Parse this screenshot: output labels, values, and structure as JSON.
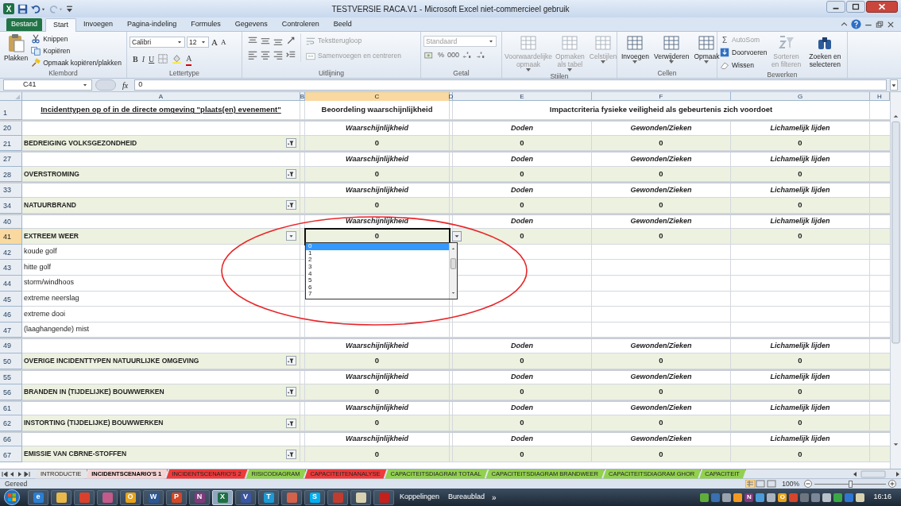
{
  "window": {
    "app_glyph": "X",
    "title": "TESTVERSIE RACA.V1  -  Microsoft Excel niet-commercieel gebruik"
  },
  "ribbon_tabs": [
    {
      "label": "Bestand",
      "kind": "file",
      "selected": false
    },
    {
      "label": "Start",
      "kind": "tab",
      "selected": true
    },
    {
      "label": "Invoegen",
      "kind": "tab",
      "selected": false
    },
    {
      "label": "Pagina-indeling",
      "kind": "tab",
      "selected": false
    },
    {
      "label": "Formules",
      "kind": "tab",
      "selected": false
    },
    {
      "label": "Gegevens",
      "kind": "tab",
      "selected": false
    },
    {
      "label": "Controleren",
      "kind": "tab",
      "selected": false
    },
    {
      "label": "Beeld",
      "kind": "tab",
      "selected": false
    }
  ],
  "ribbon_groups": [
    {
      "kind": "clipboard",
      "label": "Klembord",
      "paste": "Plakken",
      "items": [
        {
          "label": "Knippen"
        },
        {
          "label": "Kopiëren"
        },
        {
          "label": "Opmaak kopiëren/plakken"
        }
      ]
    },
    {
      "kind": "font",
      "label": "Lettertype",
      "font": "Calibri",
      "size": "12",
      "size_buttons": [
        "A",
        "A"
      ],
      "format_buttons": [
        {
          "kind": "bold",
          "glyph": "B"
        },
        {
          "kind": "italic",
          "glyph": "I"
        },
        {
          "kind": "underline",
          "glyph": "U"
        }
      ],
      "color_button": "A"
    },
    {
      "kind": "align",
      "label": "Uitlijning",
      "items": [
        {
          "label": "Tekstterugloop",
          "disabled": true
        },
        {
          "label": "Samenvoegen en centreren",
          "disabled": true
        }
      ]
    },
    {
      "kind": "number",
      "label": "Getal",
      "format": "Standaard",
      "disabled": true,
      "symbols": [
        "%",
        "000"
      ]
    },
    {
      "kind": "large",
      "label": "Stijlen",
      "items": [
        {
          "label": "Voorwaardelijke opmaak",
          "disabled": true
        },
        {
          "label": "Opmaken als tabel",
          "disabled": true
        },
        {
          "label": "Celstijlen",
          "disabled": true
        }
      ]
    },
    {
      "kind": "large",
      "label": "Cellen",
      "items": [
        {
          "label": "Invoegen",
          "disabled": false
        },
        {
          "label": "Verwijderen",
          "disabled": false
        },
        {
          "label": "Opmaak",
          "disabled": false
        }
      ]
    },
    {
      "kind": "edit",
      "label": "Bewerken",
      "small": [
        {
          "label": "AutoSom",
          "glyph": "Σ",
          "disabled": true
        },
        {
          "label": "Doorvoeren",
          "disabled": false
        },
        {
          "label": "Wissen",
          "disabled": false
        }
      ],
      "large": [
        {
          "label": "Sorteren en filteren",
          "disabled": true
        },
        {
          "label": "Zoeken en selecteren",
          "disabled": false
        }
      ]
    }
  ],
  "formula_bar": {
    "name_box": "C41",
    "function_label": "fx",
    "formula": "0"
  },
  "sheet": {
    "columns": [
      {
        "letter": "A",
        "selected": false
      },
      {
        "letter": "B",
        "selected": false
      },
      {
        "letter": "C",
        "selected": true
      },
      {
        "letter": "D",
        "selected": false
      },
      {
        "letter": "E",
        "selected": false
      },
      {
        "letter": "F",
        "selected": false
      },
      {
        "letter": "G",
        "selected": false
      },
      {
        "letter": "H",
        "selected": false
      }
    ],
    "header_row": {
      "number": "1",
      "title": "Incidenttypen op of in de directe omgeving \"plaats(en) evenement\"",
      "assessment": "Beoordeling waarschijnlijkheid",
      "impact": "Impactcriteria fysieke veiligheid als gebeurtenis zich voordoet"
    },
    "rows": [
      {
        "number": "20",
        "kind": "labels",
        "cells": [
          "Waarschijnlijkheid",
          "Doden",
          "Gewonden/Zieken",
          "Lichamelijk lijden"
        ]
      },
      {
        "number": "21",
        "kind": "category",
        "label": "BEDREIGING VOLKSGEZONDHEID",
        "filter_button": true,
        "values": [
          "0",
          "0",
          "0",
          "0"
        ],
        "active": false
      },
      {
        "number": "27",
        "kind": "labels",
        "cells": [
          "Waarschijnlijkheid",
          "Doden",
          "Gewonden/Zieken",
          "Lichamelijk lijden"
        ]
      },
      {
        "number": "28",
        "kind": "category",
        "label": "OVERSTROMING",
        "filter_button": true,
        "values": [
          "0",
          "0",
          "0",
          "0"
        ],
        "active": false
      },
      {
        "number": "33",
        "kind": "labels",
        "cells": [
          "Waarschijnlijkheid",
          "Doden",
          "Gewonden/Zieken",
          "Lichamelijk lijden"
        ]
      },
      {
        "number": "34",
        "kind": "category",
        "label": "NATUURBRAND",
        "filter_button": true,
        "values": [
          "0",
          "0",
          "0",
          "0"
        ],
        "active": false
      },
      {
        "number": "40",
        "kind": "labels",
        "cells": [
          "Waarschijnlijkheid",
          "Doden",
          "Gewonden/Zieken",
          "Lichamelijk lijden"
        ]
      },
      {
        "number": "41",
        "kind": "category",
        "label": "EXTREEM WEER",
        "filter_button": false,
        "values": [
          "0",
          "0",
          "0",
          "0"
        ],
        "active": true
      },
      {
        "number": "42",
        "kind": "item",
        "label": "koude golf"
      },
      {
        "number": "43",
        "kind": "item",
        "label": "hitte golf"
      },
      {
        "number": "44",
        "kind": "item",
        "label": "storm/windhoos"
      },
      {
        "number": "45",
        "kind": "item",
        "label": "extreme neerslag"
      },
      {
        "number": "46",
        "kind": "item",
        "label": "extreme dooi"
      },
      {
        "number": "47",
        "kind": "item",
        "label": "(laaghangende) mist"
      },
      {
        "number": "49",
        "kind": "labels",
        "cells": [
          "Waarschijnlijkheid",
          "Doden",
          "Gewonden/Zieken",
          "Lichamelijk lijden"
        ]
      },
      {
        "number": "50",
        "kind": "category",
        "label": "OVERIGE INCIDENTTYPEN NATUURLIJKE OMGEVING",
        "filter_button": true,
        "values": [
          "0",
          "0",
          "0",
          "0"
        ],
        "active": false
      },
      {
        "number": "55",
        "kind": "labels",
        "cells": [
          "Waarschijnlijkheid",
          "Doden",
          "Gewonden/Zieken",
          "Lichamelijk lijden"
        ]
      },
      {
        "number": "56",
        "kind": "category",
        "label": "BRANDEN IN (TIJDELIJKE) BOUWWERKEN",
        "filter_button": true,
        "values": [
          "0",
          "0",
          "0",
          "0"
        ],
        "active": false
      },
      {
        "number": "61",
        "kind": "labels",
        "cells": [
          "Waarschijnlijkheid",
          "Doden",
          "Gewonden/Zieken",
          "Lichamelijk lijden"
        ]
      },
      {
        "number": "62",
        "kind": "category",
        "label": "INSTORTING (TIJDELIJKE) BOUWWERKEN",
        "filter_button": true,
        "values": [
          "0",
          "0",
          "0",
          "0"
        ],
        "active": false
      },
      {
        "number": "66",
        "kind": "labels",
        "cells": [
          "Waarschijnlijkheid",
          "Doden",
          "Gewonden/Zieken",
          "Lichamelijk lijden"
        ]
      },
      {
        "number": "67",
        "kind": "category",
        "label": "EMISSIE VAN CBRNE-STOFFEN",
        "filter_button": true,
        "values": [
          "0",
          "0",
          "0",
          "0"
        ],
        "active": false
      }
    ],
    "dropdown": [
      {
        "label": "0",
        "selected": true
      },
      {
        "label": "1",
        "selected": false
      },
      {
        "label": "2",
        "selected": false
      },
      {
        "label": "3",
        "selected": false
      },
      {
        "label": "4",
        "selected": false
      },
      {
        "label": "5",
        "selected": false
      },
      {
        "label": "6",
        "selected": false
      },
      {
        "label": "7",
        "selected": false
      }
    ],
    "annotation": {
      "kind": "ellipse",
      "color": "#e8262a"
    }
  },
  "sheet_tabs": [
    {
      "label": "INTRODUCTIE",
      "color": "#e4e4e4",
      "selected": false
    },
    {
      "label": "INCIDENTSCENARIO'S 1",
      "color": "#f4d3d3",
      "selected": true
    },
    {
      "label": "INCIDENTSCENARIO'S 2",
      "color": "#ee3b3b",
      "selected": false
    },
    {
      "label": "RISICODIAGRAM",
      "color": "#92d050",
      "selected": false
    },
    {
      "label": "CAPACITEITENANALYSE",
      "color": "#ee3b3b",
      "selected": false
    },
    {
      "label": "CAPACITEITSDIAGRAM TOTAAL",
      "color": "#92d050",
      "selected": false
    },
    {
      "label": "CAPACITEITSDIAGRAM BRANDWEER",
      "color": "#92d050",
      "selected": false
    },
    {
      "label": "CAPACITEITSDIAGRAM GHOR",
      "color": "#92d050",
      "selected": false
    },
    {
      "label": "CAPACITEIT",
      "color": "#92d050",
      "selected": false
    }
  ],
  "status_bar": {
    "status": "Gereed",
    "zoom": "100%",
    "level": 0.5
  },
  "taskbar": {
    "apps": [
      {
        "glyph": "e",
        "color": "#2a7fd4",
        "selected": false
      },
      {
        "color": "#e8b84a",
        "selected": false
      },
      {
        "color": "#d9412c",
        "selected": false
      },
      {
        "color": "#c25a8a",
        "selected": false
      },
      {
        "glyph": "O",
        "color": "#e8a317",
        "selected": false
      },
      {
        "glyph": "W",
        "color": "#2b5797",
        "selected": false
      },
      {
        "glyph": "P",
        "color": "#d24726",
        "selected": false
      },
      {
        "glyph": "N",
        "color": "#80397b",
        "selected": false
      },
      {
        "glyph": "X",
        "color": "#1d7044",
        "selected": true
      },
      {
        "glyph": "V",
        "color": "#3955a3",
        "selected": false
      },
      {
        "glyph": "T",
        "color": "#1b9ad6",
        "selected": false
      },
      {
        "color": "#d4614a",
        "selected": false
      },
      {
        "glyph": "S",
        "color": "#00aff0",
        "selected": false
      },
      {
        "color": "#c23b2f",
        "selected": false
      },
      {
        "color": "#d8d2b0",
        "selected": false
      },
      {
        "color": "#c4201d",
        "selected": false
      }
    ],
    "toolbars": [
      "Koppelingen",
      "Bureaublad"
    ],
    "more": "»",
    "tray": [
      {
        "color": "#5fae3b"
      },
      {
        "color": "#3a6fb0"
      },
      {
        "color": "#9aa3ad"
      },
      {
        "color": "#f29a1f"
      },
      {
        "glyph": "N",
        "color": "#80397b"
      },
      {
        "color": "#4a9bd8"
      },
      {
        "color": "#a8b3bd"
      },
      {
        "glyph": "O",
        "color": "#e8a317"
      },
      {
        "color": "#d4452c"
      },
      {
        "color": "#6d7680"
      },
      {
        "color": "#7b8796"
      },
      {
        "color": "#b9c2c9"
      },
      {
        "color": "#3aa845"
      },
      {
        "color": "#2f76d2"
      },
      {
        "color": "#d8d2b0"
      }
    ],
    "time": "16:16"
  }
}
